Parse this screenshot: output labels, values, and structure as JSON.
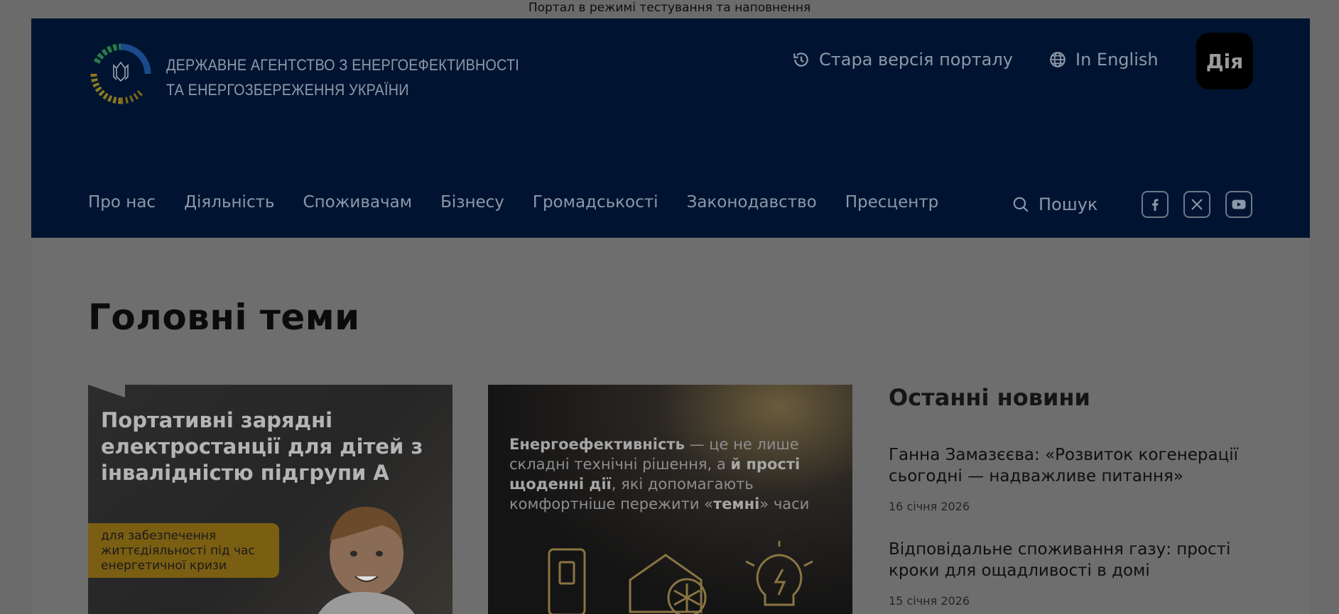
{
  "top_notice": "Портал в режимі тестування та наповнення",
  "header": {
    "agency_line1": "ДЕРЖАВНЕ АГЕНТСТВО З ЕНЕРГОЕФЕКТИВНОСТІ",
    "agency_line2": "ТА ЕНЕРГОЗБЕРЕЖЕННЯ УКРАЇНИ",
    "old_version": "Стара версія порталу",
    "english": "In English",
    "diia": "Дія"
  },
  "nav": {
    "items": [
      "Про нас",
      "Діяльність",
      "Споживачам",
      "Бізнесу",
      "Громадськості",
      "Законодавство",
      "Пресцентр"
    ],
    "search": "Пошук"
  },
  "social": [
    "facebook-icon",
    "x-icon",
    "youtube-icon"
  ],
  "main": {
    "title": "Головні теми",
    "card1": {
      "title": "Портативні зарядні електростанції для дітей з інвалідністю підгрупи А",
      "badge": "для забезпечення життєдіяльності під час енергетичної кризи"
    },
    "card2": {
      "text_a": "Енергоефективність",
      "text_b": " — це не лише складні технічні рішення, а ",
      "text_c": "й прості щоденні дії",
      "text_d": ", які допомагають комфортніше пережити «",
      "text_e": "темні",
      "text_f": "» часи"
    }
  },
  "news": {
    "title": "Останні новини",
    "items": [
      {
        "headline": "Ганна Замазєєва: «Розвиток когенерації сьогодні — надважливе питання»",
        "date": "16 січня 2026"
      },
      {
        "headline": "Відповідальне споживання газу: прості кроки для ощадливості в домі",
        "date": "15 січня 2026"
      }
    ]
  },
  "colors": {
    "header_bg": "#001431",
    "overlay_bg": "#6e6e6e",
    "badge_bg": "#7a5e12"
  }
}
